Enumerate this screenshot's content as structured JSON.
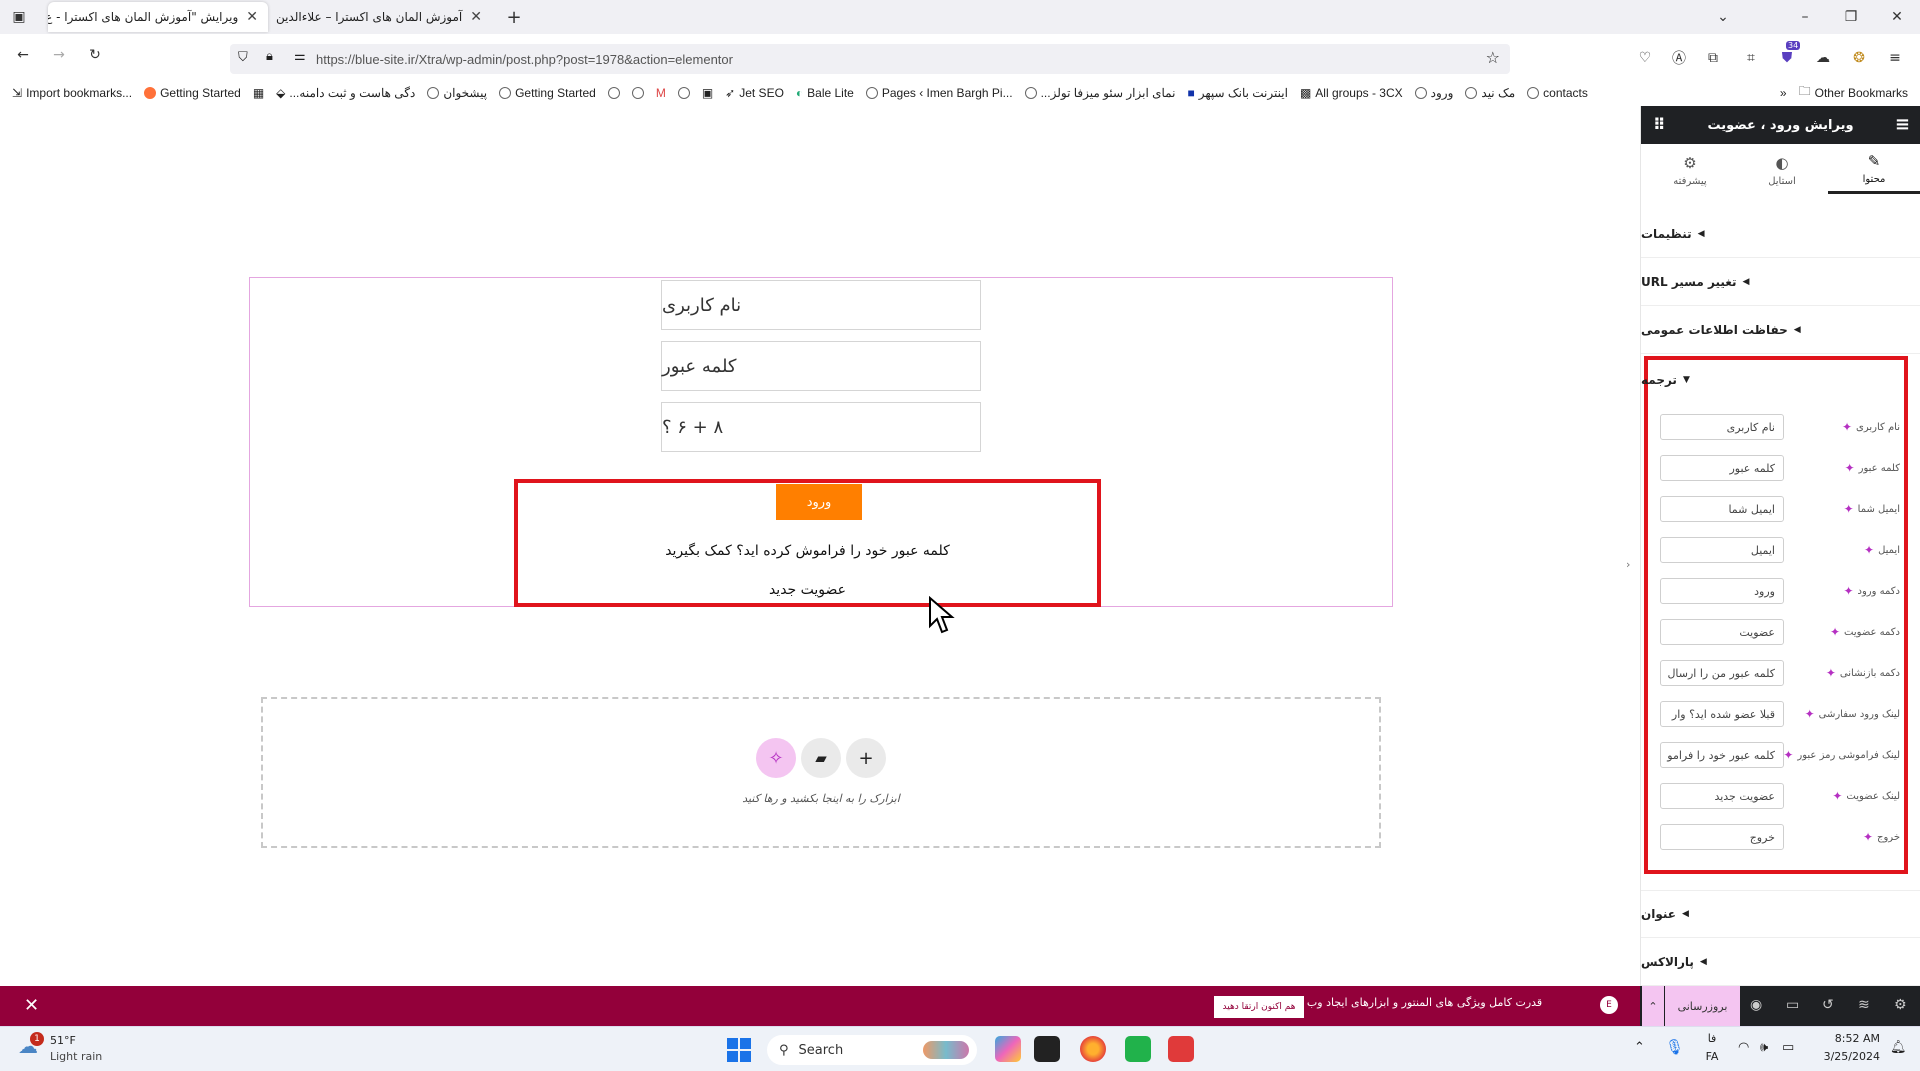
{
  "browser": {
    "tabs": [
      {
        "label": "ویرایش \"آموزش المان های اکسترا - ع",
        "active": true
      },
      {
        "label": "آموزش المان های اکسترا – علاءالدین",
        "active": false
      }
    ],
    "url": "https://blue-site.ir/Xtra/wp-admin/post.php?post=1978&action=elementor",
    "extension_badge": "34",
    "bookmarks": [
      "Import bookmarks...",
      "Getting Started",
      "...دگی هاست و ثبت دامنه",
      "پیشخوان",
      "Getting Started",
      "Jet SEO",
      "Bale Lite",
      "Pages ‹ Imen Bargh Pi...",
      "...نمای ابزار سئو میزفا تولز",
      "اینترنت بانک سپهر",
      "All groups - 3CX",
      "ورود",
      "مک نید",
      "contacts"
    ],
    "other_bookmarks": "Other Bookmarks"
  },
  "canvas": {
    "fields": [
      "نام کاربری",
      "کلمه عبور",
      "۸ + ۶ ؟"
    ],
    "login_button": "ورود",
    "forgot_link": "کلمه عبور خود را فراموش کرده اید؟ کمک بگیرید",
    "register_link": "عضویت جدید",
    "dropzone_text": "ابزارک را به اینجا بکشید و رها کنید"
  },
  "panel": {
    "title": "ویرایش ورود ، عضویت",
    "tabs": [
      "محتوا",
      "استایل",
      "پیشرفته"
    ],
    "sections": [
      "تنظیمات",
      "تغییر مسیر URL",
      "حفاظت اطلاعات عمومی"
    ],
    "translation_title": "ترجمه",
    "translation_rows": [
      {
        "label": "نام کاربری",
        "value": "نام کاربری"
      },
      {
        "label": "کلمه عبور",
        "value": "کلمه عبور"
      },
      {
        "label": "ایمیل شما",
        "value": "ایمیل شما"
      },
      {
        "label": "ایمیل",
        "value": "ایمیل"
      },
      {
        "label": "دکمه ورود",
        "value": "ورود"
      },
      {
        "label": "دکمه عضویت",
        "value": "عضویت"
      },
      {
        "label": "دکمه بازنشانی",
        "value": "کلمه عبور من را ارسال"
      },
      {
        "label": "لینک ورود سفارشی",
        "value": "قبلا عضو شده اید؟ وار"
      },
      {
        "label": "لینک فراموشی رمز عبور",
        "value": "کلمه عبور خود را فرامو"
      },
      {
        "label": "لینک عضویت",
        "value": "عضویت جدید"
      },
      {
        "label": "خروج",
        "value": "خروج"
      }
    ],
    "bottom_sections": [
      "عنوان",
      "پارالاکس"
    ]
  },
  "bottombar": {
    "message": "قدرت کامل ویژگی های المنتور و ابزارهای ایجاد وب را فعال کنید.",
    "upgrade": "هم اکنون ارتقا دهید",
    "publish": "بروزرسانی"
  },
  "taskbar": {
    "weather_temp": "51°F",
    "weather_desc": "Light rain",
    "weather_badge": "1",
    "search": "Search",
    "lang_top": "فا",
    "lang_bottom": "FA",
    "time": "8:52 AM",
    "date": "3/25/2024"
  },
  "colors": {
    "accent": "#93003a",
    "login_button": "#ff7f00",
    "highlight": "#e0141c"
  }
}
